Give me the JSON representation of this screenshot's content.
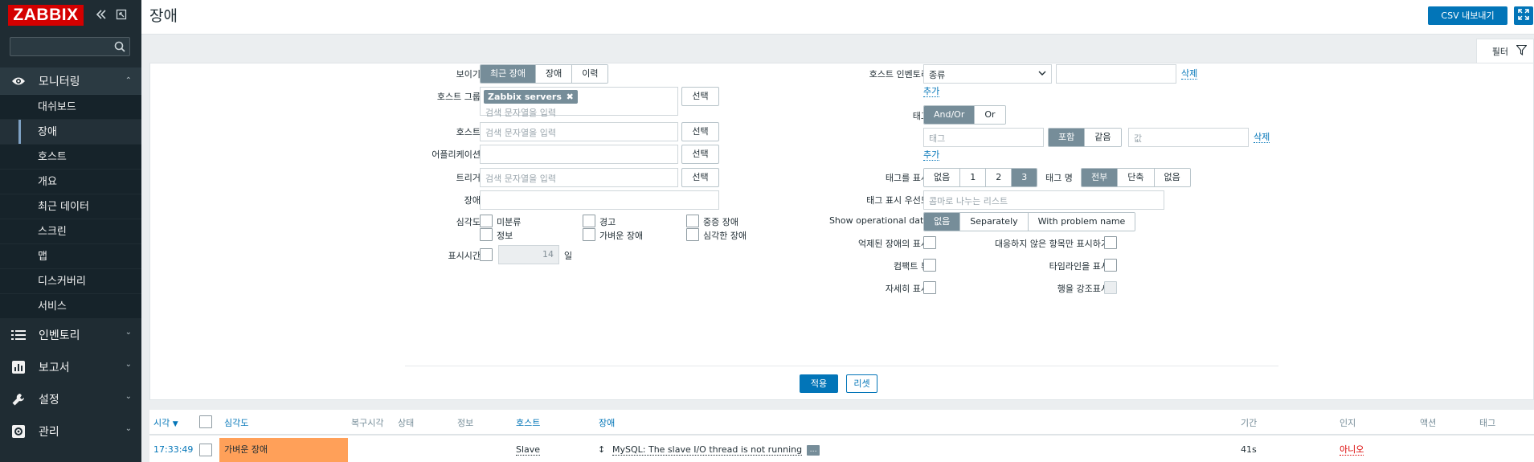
{
  "app": {
    "logo": "ZABBIX",
    "collapse_icon": "double-chevron-left-icon",
    "kiosk_icon": "kiosk-icon"
  },
  "sidebar": {
    "search_value": "",
    "sections": [
      {
        "label": "모니터링",
        "icon": "eye-icon",
        "expanded": true,
        "items": [
          {
            "label": "대쉬보드",
            "active": false
          },
          {
            "label": "장애",
            "active": true
          },
          {
            "label": "호스트",
            "active": false
          },
          {
            "label": "개요",
            "active": false
          },
          {
            "label": "최근 데이터",
            "active": false
          },
          {
            "label": "스크린",
            "active": false
          },
          {
            "label": "맵",
            "active": false
          },
          {
            "label": "디스커버리",
            "active": false
          },
          {
            "label": "서비스",
            "active": false
          }
        ]
      },
      {
        "label": "인벤토리",
        "icon": "list-icon",
        "expanded": false
      },
      {
        "label": "보고서",
        "icon": "bar-chart-icon",
        "expanded": false
      },
      {
        "label": "설정",
        "icon": "wrench-icon",
        "expanded": false
      },
      {
        "label": "관리",
        "icon": "gear-icon",
        "expanded": false
      }
    ]
  },
  "header": {
    "title": "장애",
    "csv_button": "CSV 내보내기",
    "fullscreen_icon": "fullscreen-icon"
  },
  "filter_tab": {
    "label": "필터",
    "icon": "filter-icon"
  },
  "filter": {
    "show": {
      "label": "보이기",
      "options": [
        "최근 장애",
        "장애",
        "이력"
      ],
      "selected": "최근 장애"
    },
    "host_groups": {
      "label": "호스트 그룹",
      "chips": [
        "Zabbix servers"
      ],
      "placeholder": "검색 문자열을 입력",
      "select_button": "선택"
    },
    "hosts": {
      "label": "호스트",
      "placeholder": "검색 문자열을 입력",
      "select_button": "선택"
    },
    "application": {
      "label": "어플리케이션",
      "value": "",
      "select_button": "선택"
    },
    "triggers": {
      "label": "트리거",
      "placeholder": "검색 문자열을 입력",
      "select_button": "선택"
    },
    "problem": {
      "label": "장애",
      "value": ""
    },
    "severity": {
      "label": "심각도",
      "options": [
        "미분류",
        "경고",
        "중증 장애",
        "정보",
        "가벼운 장애",
        "심각한 장애"
      ]
    },
    "age": {
      "label": "표시시간",
      "value": "14",
      "unit": "일"
    },
    "host_inventory": {
      "label": "호스트 인벤토리",
      "field_selected": "종류",
      "value": "",
      "remove_link": "삭제",
      "add_link": "추가"
    },
    "tags": {
      "label": "태그",
      "operator_options": [
        "And/Or",
        "Or"
      ],
      "operator_selected": "And/Or",
      "tag_placeholder": "태그",
      "match_options": [
        "포함",
        "같음"
      ],
      "match_selected": "포함",
      "value_placeholder": "값",
      "remove_link": "삭제",
      "add_link": "추가"
    },
    "show_tags": {
      "label": "태그를 표시",
      "options": [
        "없음",
        "1",
        "2",
        "3"
      ],
      "selected": "3"
    },
    "tag_name": {
      "label": "태그 명",
      "options": [
        "전부",
        "단축",
        "없음"
      ],
      "selected": "전부"
    },
    "tag_priority": {
      "label": "태그 표시 우선도",
      "placeholder": "콤마로 나누는 리스트"
    },
    "operational_data": {
      "label": "Show operational data",
      "options": [
        "없음",
        "Separately",
        "With problem name"
      ],
      "selected": "없음"
    },
    "suppressed": {
      "label": "억제된 장애의 표시"
    },
    "unacknowledged": {
      "label": "대응하지 않은 항목만 표시하기"
    },
    "compact_view": {
      "label": "컴팩트 뷰"
    },
    "show_timeline": {
      "label": "타임라인을 표시"
    },
    "show_details": {
      "label": "자세히 표시"
    },
    "highlight_row": {
      "label": "행을 강조표시"
    },
    "apply_button": "적용",
    "reset_button": "리셋"
  },
  "table": {
    "columns": [
      "시각",
      "심각도",
      "복구시각",
      "상태",
      "정보",
      "호스트",
      "장애",
      "기간",
      "인지",
      "액션",
      "태그"
    ],
    "rows": [
      {
        "time": "17:33:49",
        "severity": "가벼운 장애",
        "recovery_time": "",
        "status": "",
        "info": "",
        "host": "Slave",
        "problem": "MySQL: The slave I/O thread is not running",
        "duration": "41s",
        "ack": "아니오",
        "actions": "",
        "tags": ""
      }
    ],
    "colors": {
      "severity_average": "#ffa059",
      "ack_no": "#dc0000",
      "link": "#0275b8"
    }
  }
}
